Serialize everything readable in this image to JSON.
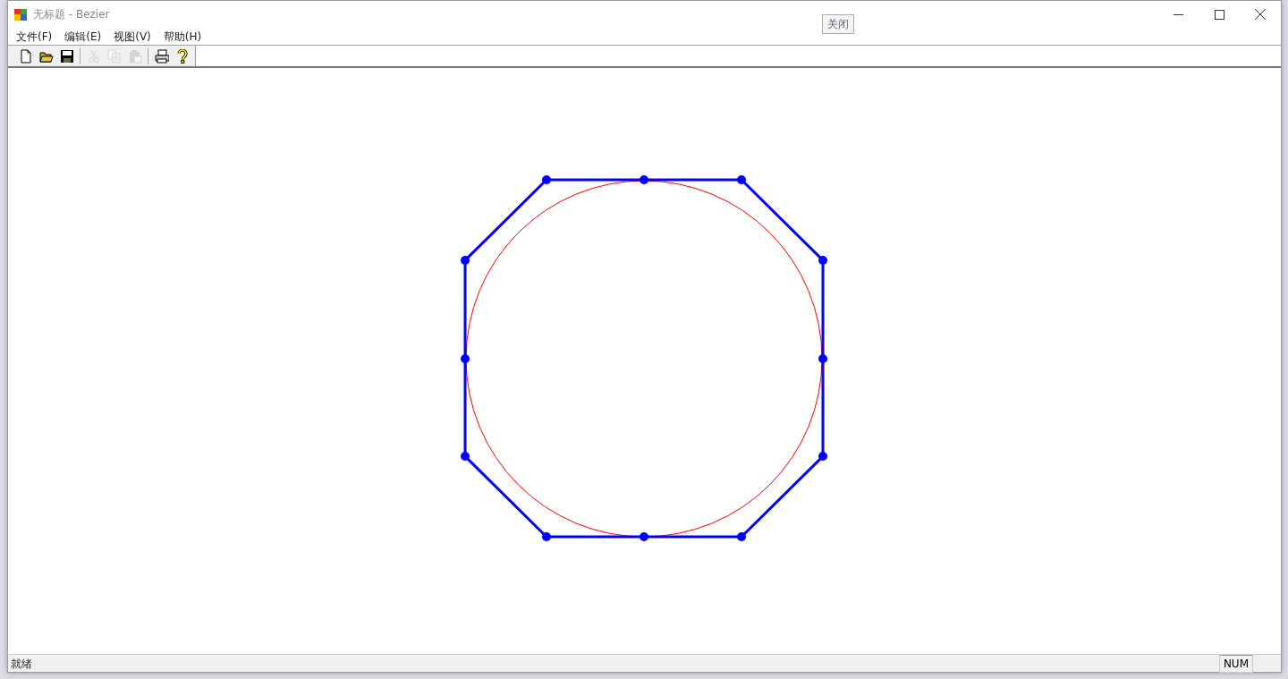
{
  "window": {
    "title": "无标题 - Bezier"
  },
  "floating_button": {
    "label": "关闭"
  },
  "menu": [
    {
      "label": "文件(F)"
    },
    {
      "label": "编辑(E)"
    },
    {
      "label": "视图(V)"
    },
    {
      "label": "帮助(H)"
    }
  ],
  "toolbar": [
    {
      "kind": "new",
      "disabled": false
    },
    {
      "kind": "open",
      "disabled": false
    },
    {
      "kind": "save",
      "disabled": false
    },
    {
      "kind": "separator"
    },
    {
      "kind": "cut",
      "disabled": true
    },
    {
      "kind": "copy",
      "disabled": true
    },
    {
      "kind": "paste",
      "disabled": true
    },
    {
      "kind": "separator"
    },
    {
      "kind": "print",
      "disabled": false
    },
    {
      "kind": "help",
      "disabled": false
    }
  ],
  "status_bar": {
    "message": "就绪",
    "indicators": [
      {
        "label": "NUM"
      }
    ]
  }
}
